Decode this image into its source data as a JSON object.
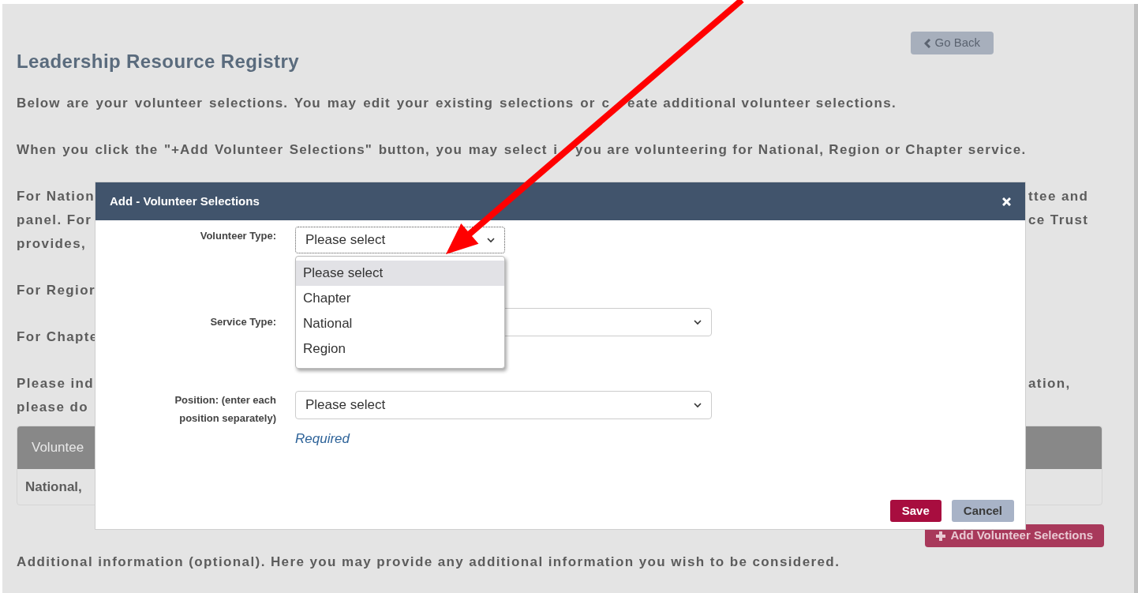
{
  "page": {
    "title": "Leadership Resource Registry",
    "go_back": "Go Back",
    "paragraphs": [
      {
        "lines": [
          {
            "left": "Below are your volunteer selections. You may edit your existing selections or c",
            "after_arrow": "eate additional volunteer selections."
          }
        ]
      },
      {
        "lines": [
          {
            "left": "When you click the \"+Add Volunteer Selections\" button, you may select i",
            "after_arrow": "you are volunteering for National, Region or Chapter service."
          }
        ]
      },
      {
        "lines": [
          {
            "left": "For Nation",
            "right": "ttee and"
          },
          {
            "left": "panel. For",
            "right": "ce Trust"
          },
          {
            "left": "provides,"
          }
        ]
      },
      {
        "lines": [
          {
            "left": "For Regior"
          }
        ]
      },
      {
        "lines": [
          {
            "left": "For Chapte"
          }
        ]
      },
      {
        "lines": [
          {
            "left": "Please ind",
            "right": "ation,"
          },
          {
            "left": "please do"
          }
        ]
      }
    ],
    "table": {
      "column_1": "Voluntee",
      "rows": [
        {
          "column_1": "National,"
        }
      ]
    },
    "add_button": "Add Volunteer Selections",
    "additional_info": "Additional information (optional). Here you may provide any additional information you wish to be considered."
  },
  "modal": {
    "title": "Add - Volunteer Selections",
    "fields": [
      {
        "label": "Volunteer Type:",
        "value": "Please select",
        "expanded": true,
        "options": [
          {
            "label": "Please select",
            "selected": true
          },
          {
            "label": "Chapter",
            "selected": false
          },
          {
            "label": "National",
            "selected": false
          },
          {
            "label": "Region",
            "selected": false
          }
        ]
      },
      {
        "label": "Service Type:",
        "expanded": false
      },
      {
        "label": "Position: (enter each position separately)",
        "value": "Please select",
        "expanded": false,
        "hint": "Required"
      }
    ],
    "buttons": [
      {
        "label": "Save",
        "kind": "primary"
      },
      {
        "label": "Cancel",
        "kind": "secondary"
      }
    ]
  }
}
